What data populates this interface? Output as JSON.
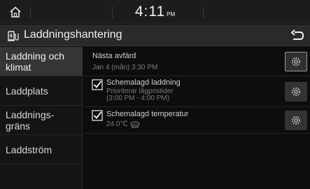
{
  "status": {
    "time": "4:11",
    "ampm": "PM"
  },
  "header": {
    "title": "Laddningshantering"
  },
  "sidebar": {
    "items": [
      {
        "label": "Laddning och\nklimat",
        "active": true
      },
      {
        "label": "Laddplats",
        "active": false
      },
      {
        "label": "Laddnings-\ngräns",
        "active": false
      },
      {
        "label": "Laddström",
        "active": false
      }
    ]
  },
  "main": {
    "next_departure": {
      "title": "Nästa avfärd",
      "subtitle": "Jan 4 (mån) 3:30 PM"
    },
    "scheduled_charging": {
      "label": "Schemalagd laddning",
      "checked": true,
      "line1": "Prioriterar lågpristider",
      "line2": "(3:00 PM - 4:00 PM)"
    },
    "scheduled_temperature": {
      "label": "Schemalagd temperatur",
      "checked": true,
      "value": "24.0℃"
    }
  },
  "icons": {
    "home": "home-icon",
    "charging": "charging-station-icon",
    "back": "back-arrow-icon",
    "settings": "gear-icon",
    "defrost": "defrost-icon",
    "checkbox": "checkbox-checked-icon"
  },
  "colors": {
    "background": "#0d0d0d",
    "active_item": "#353535",
    "button": "#333333"
  }
}
